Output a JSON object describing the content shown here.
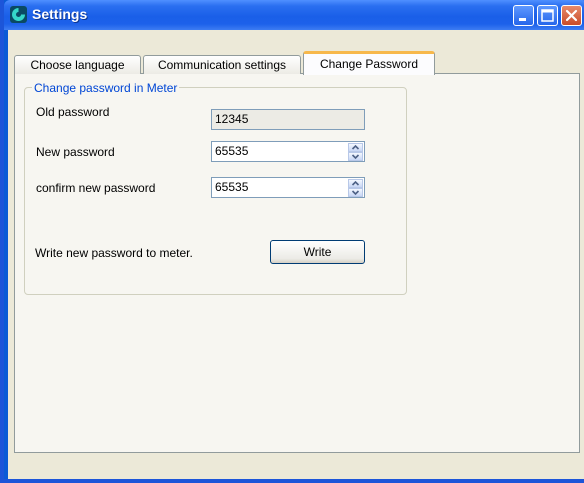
{
  "window": {
    "title": "Settings"
  },
  "tabs": [
    {
      "label": "Choose language"
    },
    {
      "label": "Communication settings"
    },
    {
      "label": "Change Password"
    }
  ],
  "group": {
    "title": "Change password in Meter",
    "old_password_label": "Old password",
    "old_password_value": "12345",
    "new_password_label": "New password",
    "new_password_value": "65535",
    "confirm_password_label": "confirm new password",
    "confirm_password_value": "65535",
    "write_instruction": "Write new password to meter.",
    "write_button": "Write"
  },
  "icons": {
    "app": "app-logo-icon",
    "minimize": "minimize-icon",
    "maximize": "maximize-icon",
    "close": "close-icon"
  },
  "colors": {
    "titlebar": "#1a5fe8",
    "client_bg": "#ece9d8",
    "group_title": "#0046d5",
    "active_tab_accent": "#f7b84b"
  }
}
